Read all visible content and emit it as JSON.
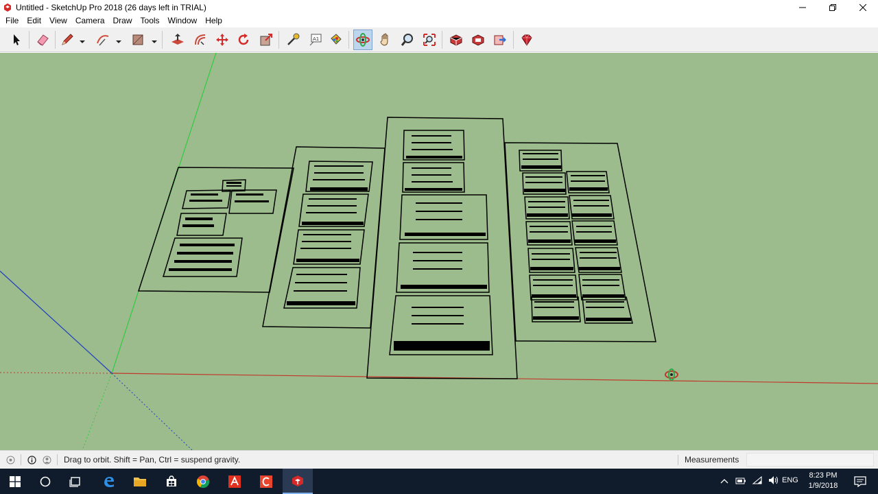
{
  "window": {
    "title": "Untitled - SketchUp Pro 2018 (26 days left in TRIAL)"
  },
  "menu": [
    "File",
    "Edit",
    "View",
    "Camera",
    "Draw",
    "Tools",
    "Window",
    "Help"
  ],
  "toolbar": {
    "tools": [
      {
        "name": "select-tool",
        "icon": "arrow-cursor-icon"
      },
      {
        "name": "eraser-tool",
        "icon": "eraser-icon"
      },
      {
        "name": "line-tool",
        "icon": "pencil-icon"
      },
      {
        "name": "arc-tool",
        "icon": "arc-icon"
      },
      {
        "name": "shapes-tool",
        "icon": "rectangle-icon"
      },
      {
        "name": "push-pull-tool",
        "icon": "push-pull-icon"
      },
      {
        "name": "offset-tool",
        "icon": "offset-icon"
      },
      {
        "name": "move-tool",
        "icon": "move-icon"
      },
      {
        "name": "rotate-tool",
        "icon": "rotate-icon"
      },
      {
        "name": "scale-tool",
        "icon": "scale-icon"
      },
      {
        "name": "tape-measure-tool",
        "icon": "tape-measure-icon"
      },
      {
        "name": "text-tool",
        "icon": "text-icon"
      },
      {
        "name": "paint-bucket-tool",
        "icon": "paint-bucket-icon"
      },
      {
        "name": "orbit-tool",
        "icon": "orbit-icon",
        "active": true
      },
      {
        "name": "pan-tool",
        "icon": "hand-icon"
      },
      {
        "name": "zoom-tool",
        "icon": "magnifier-icon"
      },
      {
        "name": "zoom-extents-tool",
        "icon": "zoom-extents-icon"
      },
      {
        "name": "warehouse-tool",
        "icon": "3d-warehouse-icon"
      },
      {
        "name": "extension-warehouse-tool",
        "icon": "extension-warehouse-icon"
      },
      {
        "name": "send-to-layout-tool",
        "icon": "send-to-layout-icon"
      },
      {
        "name": "extension-manager-tool",
        "icon": "ruby-gem-icon"
      }
    ]
  },
  "status": {
    "hint": "Drag to orbit. Shift = Pan, Ctrl = suspend gravity.",
    "measurements_label": "Measurements",
    "measurements_value": ""
  },
  "taskbar": {
    "apps": [
      "start-icon",
      "cortana-icon",
      "task-view-icon",
      "edge-icon",
      "file-explorer-icon",
      "store-icon",
      "chrome-icon",
      "acrobat-icon",
      "app-icon",
      "sketchup-icon"
    ],
    "language": "ENG",
    "time": "8:23 PM",
    "date": "1/9/2018"
  },
  "colors": {
    "viewport_bg": "#9dbc8d",
    "red_axis": "#c0392b",
    "green_axis": "#2ecc40",
    "blue_axis": "#1f3fbf",
    "taskbar_bg": "#101b2b"
  }
}
